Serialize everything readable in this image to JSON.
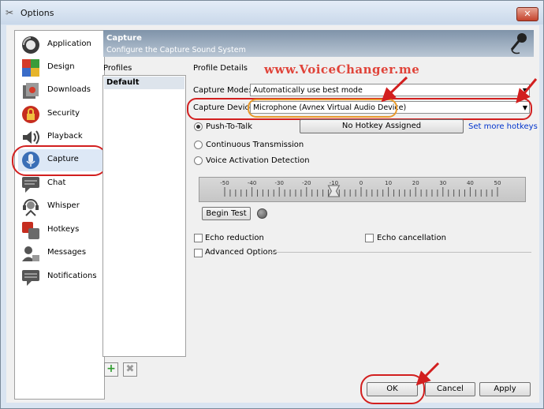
{
  "window": {
    "title": "Options",
    "close_label": "✕"
  },
  "nav": {
    "items": [
      {
        "label": "Application",
        "icon": "application-icon"
      },
      {
        "label": "Design",
        "icon": "design-icon"
      },
      {
        "label": "Downloads",
        "icon": "downloads-icon"
      },
      {
        "label": "Security",
        "icon": "security-icon"
      },
      {
        "label": "Playback",
        "icon": "playback-icon"
      },
      {
        "label": "Capture",
        "icon": "capture-icon"
      },
      {
        "label": "Chat",
        "icon": "chat-icon"
      },
      {
        "label": "Whisper",
        "icon": "whisper-icon"
      },
      {
        "label": "Hotkeys",
        "icon": "hotkeys-icon"
      },
      {
        "label": "Messages",
        "icon": "messages-icon"
      },
      {
        "label": "Notifications",
        "icon": "notifications-icon"
      }
    ],
    "selected": "Capture"
  },
  "header": {
    "title": "Capture",
    "subtitle": "Configure the Capture Sound System"
  },
  "profiles": {
    "label": "Profiles",
    "items": [
      "Default"
    ],
    "add_label": "+",
    "remove_label": "✖"
  },
  "details": {
    "label": "Profile Details",
    "watermark": "www.VoiceChanger.me",
    "capture_mode_label": "Capture Mode:",
    "capture_mode_value": "Automatically use best mode",
    "capture_device_label": "Capture Device:",
    "capture_device_value": "Microphone (Avnex Virtual Audio Device)",
    "push_to_talk_label": "Push-To-Talk",
    "hotkey_button": "No Hotkey Assigned",
    "set_more_hotkeys": "Set more hotkeys",
    "continuous_label": "Continuous Transmission",
    "vad_label": "Voice Activation Detection",
    "slider_ticks": [
      "-50",
      "-40",
      "-30",
      "-20",
      "-10",
      "0",
      "10",
      "20",
      "30",
      "40",
      "50"
    ],
    "slider_value": -10,
    "begin_test": "Begin Test",
    "echo_reduction": "Echo reduction",
    "echo_cancellation": "Echo cancellation",
    "advanced_options": "Advanced Options"
  },
  "footer": {
    "ok": "OK",
    "cancel": "Cancel",
    "apply": "Apply"
  },
  "colors": {
    "annotation_red": "#d21f1f",
    "annotation_orange": "#e89a2c",
    "link": "#0033cc"
  }
}
